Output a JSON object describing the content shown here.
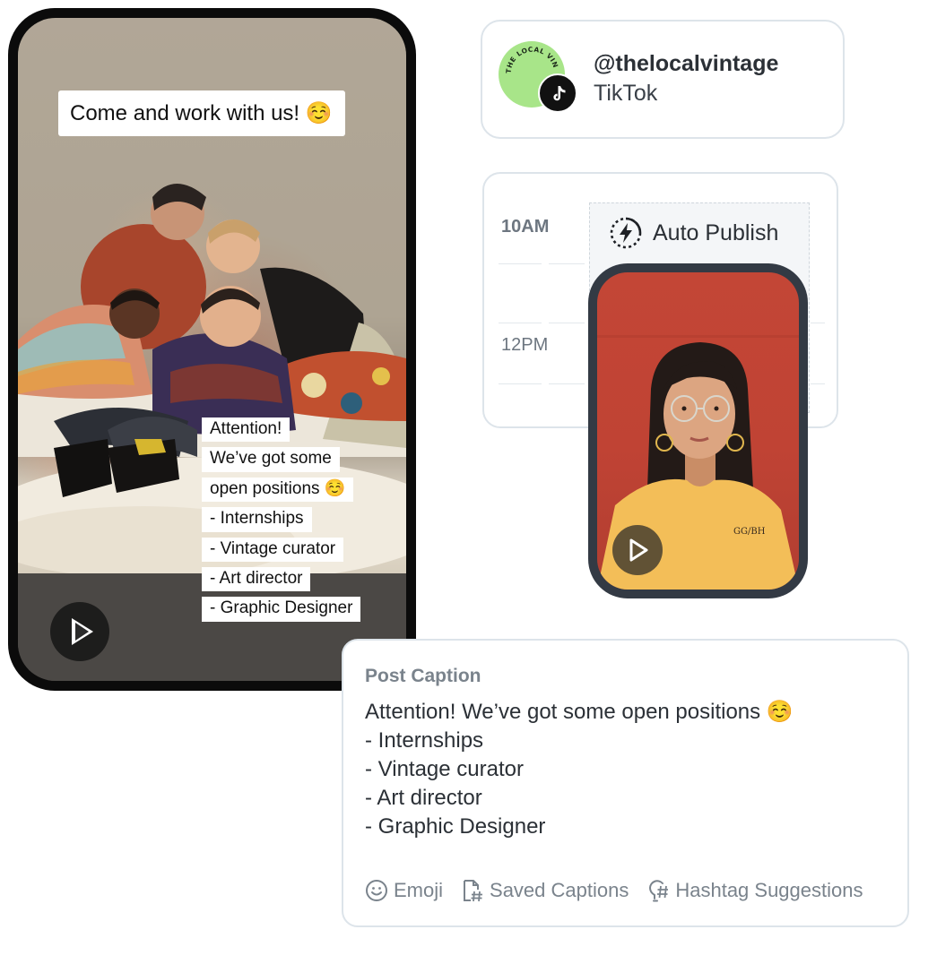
{
  "left_phone": {
    "overlay_title": "Come and work with us! ☺️",
    "overlay_lines": [
      "Attention!",
      "We’ve got some",
      "open positions ☺️",
      "- Internships",
      "- Vintage curator",
      "- Art director",
      "- Graphic Designer"
    ],
    "play_icon": "play-icon"
  },
  "profile": {
    "handle": "@thelocalvintage",
    "platform": "TikTok",
    "avatar_text": "THE LOCAL VINTAGE",
    "badge_icon": "tiktok-logo-icon",
    "avatar_color": "#a8e589"
  },
  "schedule": {
    "times": [
      "10AM",
      "12PM"
    ],
    "auto_publish_label": "Auto Publish",
    "auto_publish_icon": "lightning-timer-icon"
  },
  "right_phone": {
    "shirt_text": "GG/BH",
    "play_icon": "play-icon"
  },
  "caption": {
    "heading": "Post Caption",
    "lines": [
      "Attention! We’ve got some open positions ☺️",
      "- Internships",
      "- Vintage curator",
      "- Art director",
      "- Graphic Designer"
    ],
    "tools": [
      {
        "label": "Emoji",
        "icon": "smiley-icon"
      },
      {
        "label": "Saved Captions",
        "icon": "saved-captions-icon"
      },
      {
        "label": "Hashtag Suggestions",
        "icon": "hashtag-lightbulb-icon"
      }
    ]
  }
}
